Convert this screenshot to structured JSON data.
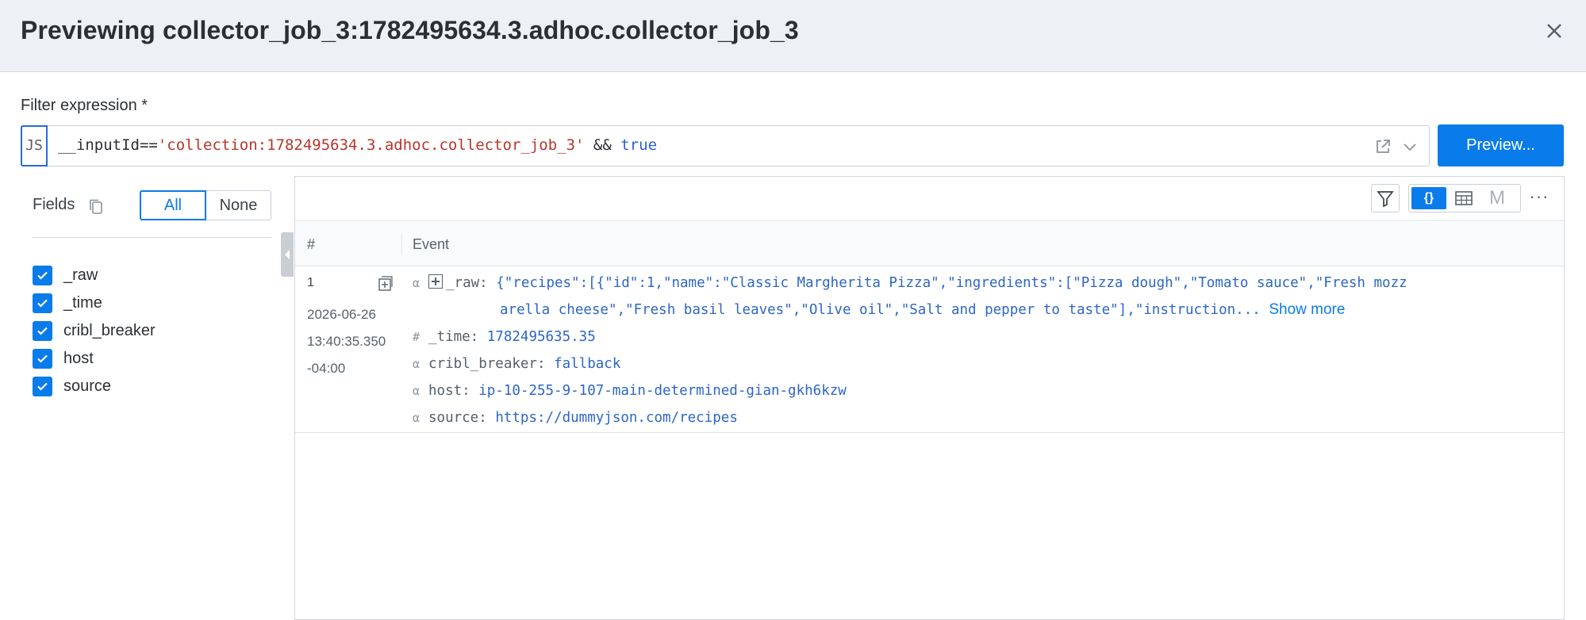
{
  "header": {
    "title": "Previewing collector_job_3:1782495634.3.adhoc.collector_job_3"
  },
  "filter": {
    "label": "Filter expression *",
    "lang_badge": "JS",
    "code_prefix": "__inputId==",
    "code_string": "'collection:1782495634.3.adhoc.collector_job_3'",
    "code_op": " && ",
    "code_keyword": "true",
    "preview_label": "Preview..."
  },
  "fields": {
    "label": "Fields",
    "all_label": "All",
    "none_label": "None",
    "items": [
      {
        "name": "_raw",
        "checked": true
      },
      {
        "name": "_time",
        "checked": true
      },
      {
        "name": "cribl_breaker",
        "checked": true
      },
      {
        "name": "host",
        "checked": true
      },
      {
        "name": "source",
        "checked": true
      }
    ]
  },
  "toolbar": {
    "json_label": "{}",
    "m_label": "M",
    "more_label": "···"
  },
  "table": {
    "col_num": "#",
    "col_event": "Event",
    "rows": [
      {
        "num": "1",
        "date": "2026-06-26",
        "time": "13:40:35.350",
        "tz": "-04:00",
        "raw_type": "α",
        "raw_key": "_raw:",
        "raw_line1": "{\"recipes\":[{\"id\":1,\"name\":\"Classic Margherita Pizza\",\"ingredients\":[\"Pizza dough\",\"Tomato sauce\",\"Fresh mozz",
        "raw_line2": "arella cheese\",\"Fresh basil leaves\",\"Olive oil\",\"Salt and pepper to taste\"],\"instruction...",
        "show_more": "Show more",
        "time_type": "#",
        "time_key": "_time:",
        "time_val": "1782495635.35",
        "breaker_type": "α",
        "breaker_key": "cribl_breaker:",
        "breaker_val": "fallback",
        "host_type": "α",
        "host_key": "host:",
        "host_val": "ip-10-255-9-107-main-determined-gian-gkh6kzw",
        "source_type": "α",
        "source_key": "source:",
        "source_val": "https://dummyjson.com/recipes"
      }
    ]
  },
  "colors": {
    "accent": "#0a7bea",
    "string": "#b8352b",
    "value": "#2d66c7"
  }
}
